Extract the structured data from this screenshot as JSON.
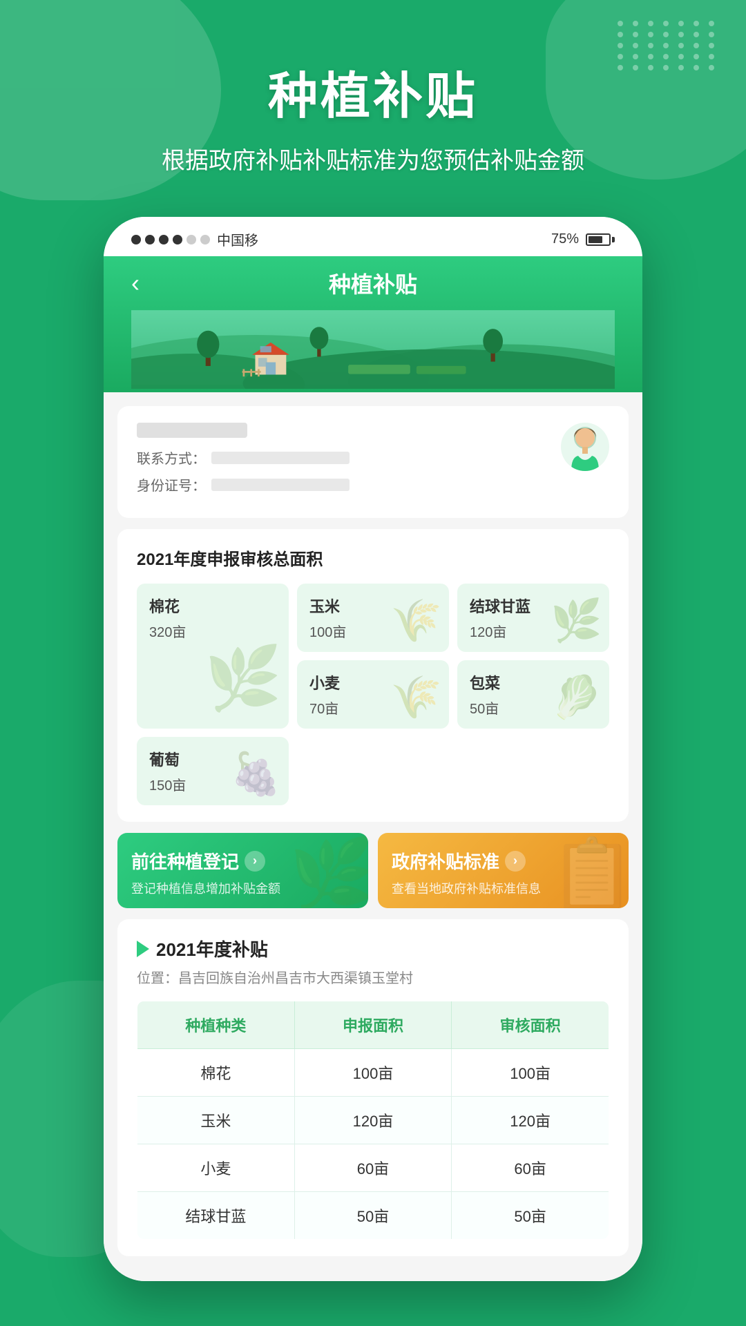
{
  "page": {
    "title": "种植补贴",
    "subtitle": "根据政府补贴补贴标准为您预估补贴金额"
  },
  "status_bar": {
    "carrier": "中国移",
    "dots": [
      "filled",
      "filled",
      "filled",
      "filled",
      "empty",
      "empty"
    ],
    "battery": "75%"
  },
  "app_header": {
    "back": "‹",
    "title": "种植补贴"
  },
  "user_card": {
    "contact_label": "联系方式：",
    "id_label": "身份证号："
  },
  "area_section": {
    "title": "2021年度申报审核总面积",
    "crops": [
      {
        "name": "棉花",
        "area": "320亩",
        "large": true
      },
      {
        "name": "玉米",
        "area": "100亩",
        "large": false
      },
      {
        "name": "结球甘蓝",
        "area": "120亩",
        "large": false
      },
      {
        "name": "小麦",
        "area": "70亩",
        "large": false
      },
      {
        "name": "包菜",
        "area": "50亩",
        "large": false
      },
      {
        "name": "葡萄",
        "area": "150亩",
        "large": false
      }
    ]
  },
  "actions": {
    "register": {
      "title": "前往种植登记",
      "subtitle": "登记种植信息增加补贴金额",
      "arrow": "›"
    },
    "standard": {
      "title": "政府补贴标准",
      "subtitle": "查看当地政府补贴标准信息",
      "arrow": "›"
    }
  },
  "subsidy_section": {
    "year_title": "2021年度补贴",
    "location_label": "位置：",
    "location": "昌吉回族自治州昌吉市大西渠镇玉堂村",
    "table": {
      "headers": [
        "种植种类",
        "申报面积",
        "审核面积"
      ],
      "rows": [
        [
          "棉花",
          "100亩",
          "100亩"
        ],
        [
          "玉米",
          "120亩",
          "120亩"
        ],
        [
          "小麦",
          "60亩",
          "60亩"
        ],
        [
          "结球甘蓝",
          "50亩",
          "50亩"
        ]
      ]
    }
  },
  "colors": {
    "primary_green": "#1aaa6a",
    "light_green": "#2ecc80",
    "orange": "#f5b942",
    "table_header_bg": "#e8f8ee",
    "table_header_text": "#2eaa60",
    "crop_card_bg": "#e8f8ee"
  }
}
